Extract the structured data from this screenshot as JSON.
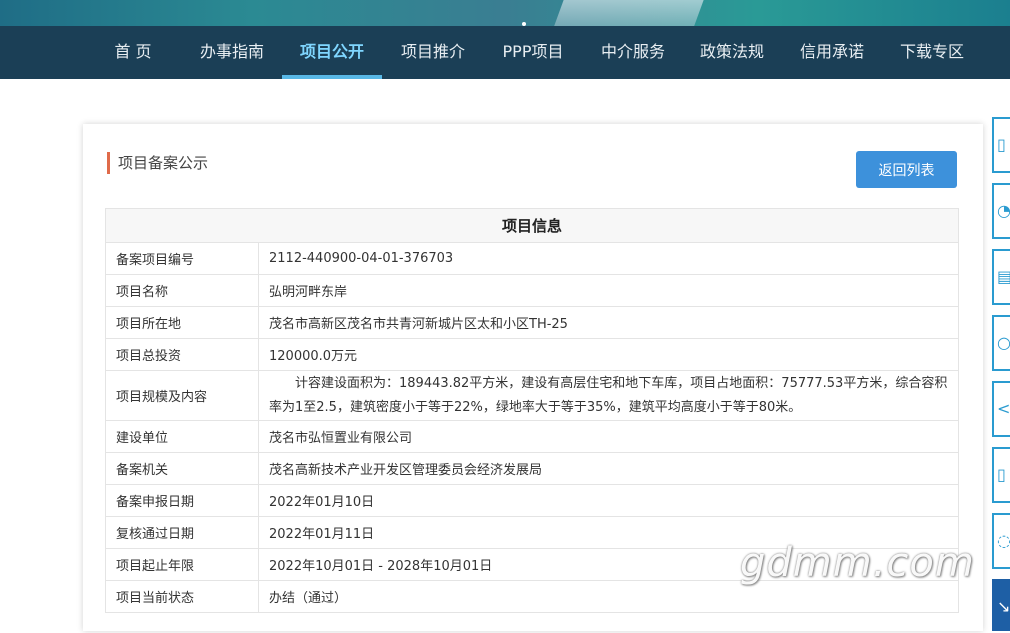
{
  "nav": {
    "items": [
      "首 页",
      "办事指南",
      "项目公开",
      "项目推介",
      "PPP项目",
      "中介服务",
      "政策法规",
      "信用承诺",
      "下载专区"
    ]
  },
  "section_title": "项目备案公示",
  "back_button": "返回列表",
  "table": {
    "header": "项目信息",
    "rows": [
      {
        "key": "备案项目编号",
        "value": "2112-440900-04-01-376703"
      },
      {
        "key": "项目名称",
        "value": "弘明河畔东岸"
      },
      {
        "key": "项目所在地",
        "value": "茂名市高新区茂名市共青河新城片区太和小区TH-25"
      },
      {
        "key": "项目总投资",
        "value": "120000.0万元"
      },
      {
        "key": "项目规模及内容",
        "value": "计容建设面积为：189443.82平方米，建设有高层住宅和地下车库，项目占地面积：75777.53平方米，综合容积率为1至2.5，建筑密度小于等于22%，绿地率大于等于35%，建筑平均高度小于等于80米。"
      },
      {
        "key": "建设单位",
        "value": "茂名市弘恒置业有限公司"
      },
      {
        "key": "备案机关",
        "value": "茂名高新技术产业开发区管理委员会经济发展局"
      },
      {
        "key": "备案申报日期",
        "value": "2022年01月10日"
      },
      {
        "key": "复核通过日期",
        "value": "2022年01月11日"
      },
      {
        "key": "项目起止年限",
        "value": "2022年10月01日 - 2028年10月01日"
      },
      {
        "key": "项目当前状态",
        "value": "办结（通过）"
      }
    ]
  },
  "watermark": "gdmm.com",
  "colors": {
    "nav_bg": "#1b3f56",
    "accent": "#3d91db",
    "title_bar": "#e06b4a"
  }
}
